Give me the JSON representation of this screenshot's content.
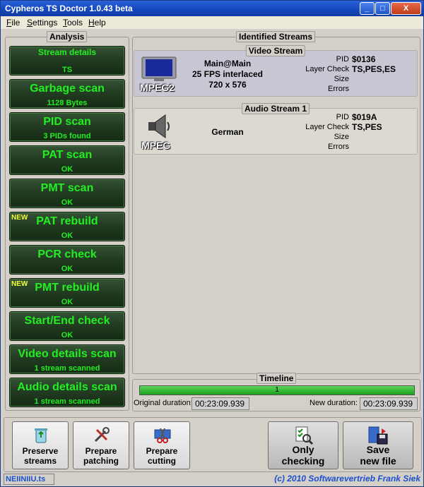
{
  "window": {
    "title": "Cypheros TS Doctor 1.0.43 beta",
    "minimize": "_",
    "maximize": "□",
    "close": "X"
  },
  "menu": [
    {
      "label": "File",
      "accel": "F",
      "rest": "ile"
    },
    {
      "label": "Settings",
      "accel": "S",
      "rest": "ettings"
    },
    {
      "label": "Tools",
      "accel": "T",
      "rest": "ools"
    },
    {
      "label": "Help",
      "accel": "H",
      "rest": "elp"
    }
  ],
  "analysis": {
    "title": "Analysis",
    "buttons": [
      {
        "label": "Stream details",
        "sub": "TS",
        "new": ""
      },
      {
        "label": "Garbage scan",
        "sub": "1128 Bytes",
        "new": ""
      },
      {
        "label": "PID scan",
        "sub": "3 PIDs found",
        "new": ""
      },
      {
        "label": "PAT scan",
        "sub": "OK",
        "new": ""
      },
      {
        "label": "PMT scan",
        "sub": "OK",
        "new": ""
      },
      {
        "label": "PAT rebuild",
        "sub": "OK",
        "new": "NEW"
      },
      {
        "label": "PCR check",
        "sub": "OK",
        "new": ""
      },
      {
        "label": "PMT rebuild",
        "sub": "OK",
        "new": "NEW"
      },
      {
        "label": "Start/End check",
        "sub": "OK",
        "new": ""
      },
      {
        "label": "Video details scan",
        "sub": "1 stream scanned",
        "new": ""
      },
      {
        "label": "Audio details scan",
        "sub": "1 stream scanned",
        "new": ""
      }
    ]
  },
  "streams": {
    "title": "Identified Streams",
    "video": {
      "title": "Video Stream",
      "codec": "MPEG2",
      "profile": "Main@Main",
      "framerate": "25 FPS interlaced",
      "resolution": "720 x 576",
      "pid_label": "PID",
      "pid": "$0136",
      "layer_label": "Layer Check",
      "layer": "TS,PES,ES",
      "size_label": "Size",
      "errors_label": "Errors"
    },
    "audio": {
      "title": "Audio Stream 1",
      "codec": "MPEG",
      "language": "German",
      "pid_label": "PID",
      "pid": "$019A",
      "layer_label": "Layer Check",
      "layer": "TS,PES",
      "size_label": "Size",
      "errors_label": "Errors"
    }
  },
  "timeline": {
    "title": "Timeline",
    "bar_value": 1,
    "bar_text": "1",
    "original_label": "Original duration:",
    "original": "00:23:09.939",
    "new_label": "New duration:",
    "new": "00:23:09.939"
  },
  "actions": [
    {
      "line1": "Preserve",
      "line2": "streams",
      "icon": "recycle-bin-icon"
    },
    {
      "line1": "Prepare",
      "line2": "patching",
      "icon": "tools-icon"
    },
    {
      "line1": "Prepare",
      "line2": "cutting",
      "icon": "scissors-film-icon"
    },
    {
      "line1": "Only",
      "line2": "checking",
      "icon": "checklist-magnifier-icon"
    },
    {
      "line1": "Save",
      "line2": "new file",
      "icon": "film-floppy-icon"
    }
  ],
  "status": {
    "filename": "NEIINIIU.ts",
    "copyright": "(c) 2010 Softwarevertrieb Frank Siek"
  },
  "colors": {
    "accent_green": "#22ee22",
    "title_blue": "#1547bb",
    "status_blue": "#1a4fd0"
  }
}
